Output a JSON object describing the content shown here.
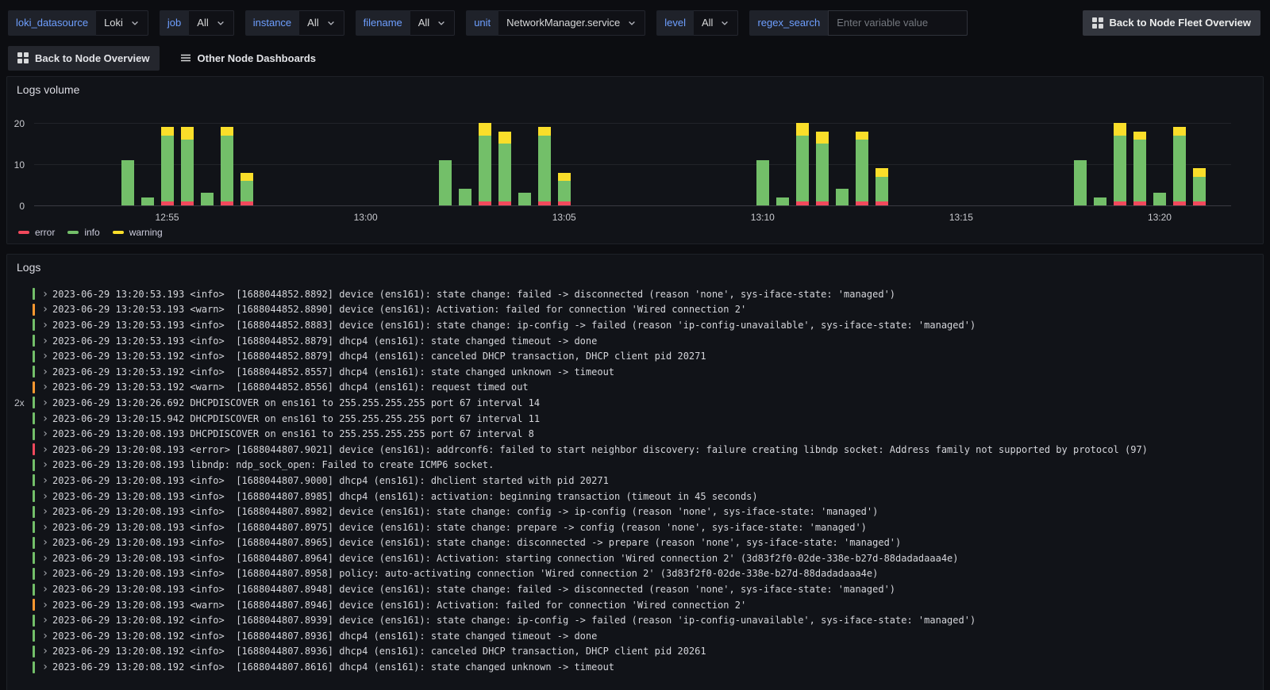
{
  "toolbar": {
    "variables": [
      {
        "name": "loki_datasource",
        "label": "loki_datasource",
        "value": "Loki",
        "type": "select"
      },
      {
        "name": "job",
        "label": "job",
        "value": "All",
        "type": "select"
      },
      {
        "name": "instance",
        "label": "instance",
        "value": "All",
        "type": "select"
      },
      {
        "name": "filename",
        "label": "filename",
        "value": "All",
        "type": "select"
      },
      {
        "name": "unit",
        "label": "unit",
        "value": "NetworkManager.service",
        "type": "select"
      },
      {
        "name": "level",
        "label": "level",
        "value": "All",
        "type": "select"
      },
      {
        "name": "regex_search",
        "label": "regex_search",
        "value": "",
        "placeholder": "Enter variable value",
        "type": "input"
      }
    ],
    "fleet_button_label": "Back to Node Fleet Overview"
  },
  "nav": {
    "back_button_label": "Back to Node Overview",
    "other_dashboards_label": "Other Node Dashboards"
  },
  "logs_volume_panel": {
    "title": "Logs volume"
  },
  "chart_data": {
    "type": "bar",
    "stacked": true,
    "title": "Logs volume",
    "legend_position": "bottom",
    "x_axis": {
      "unit": "minutes after 12:50",
      "min": 1.65,
      "max": 31.8,
      "ticks": [
        {
          "t": 5,
          "label": "12:55"
        },
        {
          "t": 10,
          "label": "13:00"
        },
        {
          "t": 15,
          "label": "13:05"
        },
        {
          "t": 20,
          "label": "13:10"
        },
        {
          "t": 25,
          "label": "13:15"
        },
        {
          "t": 30,
          "label": "13:20"
        }
      ]
    },
    "y_axis": {
      "min": 0,
      "max": 21,
      "ticks": [
        0,
        10,
        20
      ]
    },
    "legend": [
      {
        "name": "error",
        "color": "#f2495c"
      },
      {
        "name": "info",
        "color": "#73bf69"
      },
      {
        "name": "warning",
        "color": "#fade2a"
      }
    ],
    "bars": [
      {
        "t": 4.0,
        "error": 0,
        "info": 11,
        "warning": 0
      },
      {
        "t": 4.5,
        "error": 0,
        "info": 2,
        "warning": 0
      },
      {
        "t": 5.0,
        "error": 1,
        "info": 16,
        "warning": 2
      },
      {
        "t": 5.5,
        "error": 1,
        "info": 15,
        "warning": 3
      },
      {
        "t": 6.0,
        "error": 0,
        "info": 3,
        "warning": 0
      },
      {
        "t": 6.5,
        "error": 1,
        "info": 16,
        "warning": 2
      },
      {
        "t": 7.0,
        "error": 1,
        "info": 5,
        "warning": 2
      },
      {
        "t": 12.0,
        "error": 0,
        "info": 11,
        "warning": 0
      },
      {
        "t": 12.5,
        "error": 0,
        "info": 4,
        "warning": 0
      },
      {
        "t": 13.0,
        "error": 1,
        "info": 16,
        "warning": 3
      },
      {
        "t": 13.5,
        "error": 1,
        "info": 14,
        "warning": 3
      },
      {
        "t": 14.0,
        "error": 0,
        "info": 3,
        "warning": 0
      },
      {
        "t": 14.5,
        "error": 1,
        "info": 16,
        "warning": 2
      },
      {
        "t": 15.0,
        "error": 1,
        "info": 5,
        "warning": 2
      },
      {
        "t": 20.0,
        "error": 0,
        "info": 11,
        "warning": 0
      },
      {
        "t": 20.5,
        "error": 0,
        "info": 2,
        "warning": 0
      },
      {
        "t": 21.0,
        "error": 1,
        "info": 16,
        "warning": 3
      },
      {
        "t": 21.5,
        "error": 1,
        "info": 14,
        "warning": 3
      },
      {
        "t": 22.0,
        "error": 0,
        "info": 4,
        "warning": 0
      },
      {
        "t": 22.5,
        "error": 1,
        "info": 15,
        "warning": 2
      },
      {
        "t": 23.0,
        "error": 1,
        "info": 6,
        "warning": 2
      },
      {
        "t": 28.0,
        "error": 0,
        "info": 11,
        "warning": 0
      },
      {
        "t": 28.5,
        "error": 0,
        "info": 2,
        "warning": 0
      },
      {
        "t": 29.0,
        "error": 1,
        "info": 16,
        "warning": 3
      },
      {
        "t": 29.5,
        "error": 1,
        "info": 15,
        "warning": 2
      },
      {
        "t": 30.0,
        "error": 0,
        "info": 3,
        "warning": 0
      },
      {
        "t": 30.5,
        "error": 1,
        "info": 16,
        "warning": 2
      },
      {
        "t": 31.0,
        "error": 1,
        "info": 6,
        "warning": 2
      }
    ]
  },
  "logs_panel": {
    "title": "Logs",
    "rows": [
      {
        "dup": "",
        "level": "info",
        "text": "2023-06-29 13:20:53.193 <info>  [1688044852.8892] device (ens161): state change: failed -> disconnected (reason 'none', sys-iface-state: 'managed')"
      },
      {
        "dup": "",
        "level": "warn",
        "text": "2023-06-29 13:20:53.193 <warn>  [1688044852.8890] device (ens161): Activation: failed for connection 'Wired connection 2'"
      },
      {
        "dup": "",
        "level": "info",
        "text": "2023-06-29 13:20:53.193 <info>  [1688044852.8883] device (ens161): state change: ip-config -> failed (reason 'ip-config-unavailable', sys-iface-state: 'managed')"
      },
      {
        "dup": "",
        "level": "info",
        "text": "2023-06-29 13:20:53.193 <info>  [1688044852.8879] dhcp4 (ens161): state changed timeout -> done"
      },
      {
        "dup": "",
        "level": "info",
        "text": "2023-06-29 13:20:53.192 <info>  [1688044852.8879] dhcp4 (ens161): canceled DHCP transaction, DHCP client pid 20271"
      },
      {
        "dup": "",
        "level": "info",
        "text": "2023-06-29 13:20:53.192 <info>  [1688044852.8557] dhcp4 (ens161): state changed unknown -> timeout"
      },
      {
        "dup": "",
        "level": "warn",
        "text": "2023-06-29 13:20:53.192 <warn>  [1688044852.8556] dhcp4 (ens161): request timed out"
      },
      {
        "dup": "2x",
        "level": "info",
        "text": "2023-06-29 13:20:26.692 DHCPDISCOVER on ens161 to 255.255.255.255 port 67 interval 14"
      },
      {
        "dup": "",
        "level": "info",
        "text": "2023-06-29 13:20:15.942 DHCPDISCOVER on ens161 to 255.255.255.255 port 67 interval 11"
      },
      {
        "dup": "",
        "level": "info",
        "text": "2023-06-29 13:20:08.193 DHCPDISCOVER on ens161 to 255.255.255.255 port 67 interval 8"
      },
      {
        "dup": "",
        "level": "error",
        "text": "2023-06-29 13:20:08.193 <error> [1688044807.9021] device (ens161): addrconf6: failed to start neighbor discovery: failure creating libndp socket: Address family not supported by protocol (97)"
      },
      {
        "dup": "",
        "level": "info",
        "text": "2023-06-29 13:20:08.193 libndp: ndp_sock_open: Failed to create ICMP6 socket."
      },
      {
        "dup": "",
        "level": "info",
        "text": "2023-06-29 13:20:08.193 <info>  [1688044807.9000] dhcp4 (ens161): dhclient started with pid 20271"
      },
      {
        "dup": "",
        "level": "info",
        "text": "2023-06-29 13:20:08.193 <info>  [1688044807.8985] dhcp4 (ens161): activation: beginning transaction (timeout in 45 seconds)"
      },
      {
        "dup": "",
        "level": "info",
        "text": "2023-06-29 13:20:08.193 <info>  [1688044807.8982] device (ens161): state change: config -> ip-config (reason 'none', sys-iface-state: 'managed')"
      },
      {
        "dup": "",
        "level": "info",
        "text": "2023-06-29 13:20:08.193 <info>  [1688044807.8975] device (ens161): state change: prepare -> config (reason 'none', sys-iface-state: 'managed')"
      },
      {
        "dup": "",
        "level": "info",
        "text": "2023-06-29 13:20:08.193 <info>  [1688044807.8965] device (ens161): state change: disconnected -> prepare (reason 'none', sys-iface-state: 'managed')"
      },
      {
        "dup": "",
        "level": "info",
        "text": "2023-06-29 13:20:08.193 <info>  [1688044807.8964] device (ens161): Activation: starting connection 'Wired connection 2' (3d83f2f0-02de-338e-b27d-88dadadaaa4e)"
      },
      {
        "dup": "",
        "level": "info",
        "text": "2023-06-29 13:20:08.193 <info>  [1688044807.8958] policy: auto-activating connection 'Wired connection 2' (3d83f2f0-02de-338e-b27d-88dadadaaa4e)"
      },
      {
        "dup": "",
        "level": "info",
        "text": "2023-06-29 13:20:08.193 <info>  [1688044807.8948] device (ens161): state change: failed -> disconnected (reason 'none', sys-iface-state: 'managed')"
      },
      {
        "dup": "",
        "level": "warn",
        "text": "2023-06-29 13:20:08.193 <warn>  [1688044807.8946] device (ens161): Activation: failed for connection 'Wired connection 2'"
      },
      {
        "dup": "",
        "level": "info",
        "text": "2023-06-29 13:20:08.192 <info>  [1688044807.8939] device (ens161): state change: ip-config -> failed (reason 'ip-config-unavailable', sys-iface-state: 'managed')"
      },
      {
        "dup": "",
        "level": "info",
        "text": "2023-06-29 13:20:08.192 <info>  [1688044807.8936] dhcp4 (ens161): state changed timeout -> done"
      },
      {
        "dup": "",
        "level": "info",
        "text": "2023-06-29 13:20:08.192 <info>  [1688044807.8936] dhcp4 (ens161): canceled DHCP transaction, DHCP client pid 20261"
      },
      {
        "dup": "",
        "level": "info",
        "text": "2023-06-29 13:20:08.192 <info>  [1688044807.8616] dhcp4 (ens161): state changed unknown -> timeout"
      }
    ]
  },
  "colors": {
    "accent_blue": "#6e9fff",
    "levels": {
      "info": "#73bf69",
      "warn": "#ff9830",
      "error": "#f2495c"
    },
    "series": {
      "error": "#f2495c",
      "info": "#73bf69",
      "warning": "#fade2a"
    }
  }
}
